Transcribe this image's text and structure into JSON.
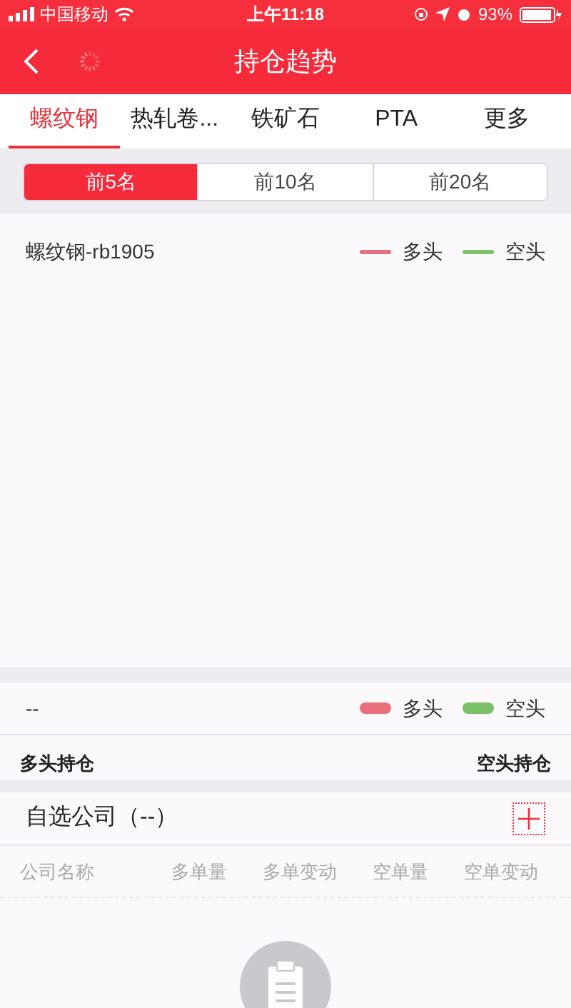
{
  "status_bar": {
    "carrier": "中国移动",
    "time": "上午11:18",
    "battery": "93%"
  },
  "header": {
    "title": "持仓趋势"
  },
  "tabs": [
    {
      "label": "螺纹钢",
      "selected": true
    },
    {
      "label": "热轧卷...",
      "selected": false
    },
    {
      "label": "铁矿石",
      "selected": false
    },
    {
      "label": "PTA",
      "selected": false
    },
    {
      "label": "更多",
      "selected": false
    }
  ],
  "rank_segments": [
    {
      "label": "前5名",
      "selected": true
    },
    {
      "label": "前10名",
      "selected": false
    },
    {
      "label": "前20名",
      "selected": false
    }
  ],
  "trend_chart": {
    "title": "螺纹钢-rb1905",
    "legend": [
      {
        "label": "多头",
        "color": "#e8707a"
      },
      {
        "label": "空头",
        "color": "#7cc06a"
      }
    ]
  },
  "position_panel": {
    "title": "--",
    "legend": [
      {
        "label": "多头",
        "color": "#e8707a"
      },
      {
        "label": "空头",
        "color": "#7cc06a"
      }
    ],
    "long_label": "多头持仓",
    "short_label": "空头持仓"
  },
  "watchlist": {
    "title": "自选公司（--）",
    "columns": [
      "公司名称",
      "多单量",
      "多单变动",
      "空单量",
      "空单变动"
    ]
  }
}
